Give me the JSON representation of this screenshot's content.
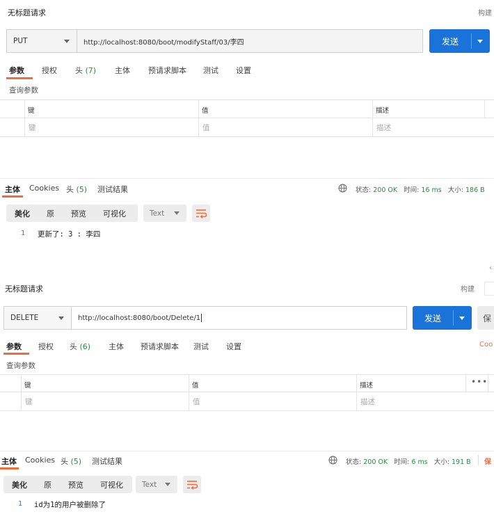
{
  "req1": {
    "title": "无标题请求",
    "build": "构建",
    "method": "PUT",
    "url": "http://localhost:8080/boot/modifyStaff/03/李四",
    "send": "发送",
    "tabs": {
      "params": "参数",
      "auth": "授权",
      "headers": "头",
      "headers_count": "(7)",
      "body": "主体",
      "prerequest": "预请求脚本",
      "tests": "测试",
      "settings": "设置"
    },
    "query_params": "查询参数",
    "table": {
      "key": "键",
      "value": "值",
      "desc": "描述",
      "key_ph": "键",
      "value_ph": "值",
      "desc_ph": "描述"
    },
    "resp_tabs": {
      "body": "主体",
      "cookies": "Cookies",
      "headers": "头",
      "headers_count": "(5)",
      "test_results": "测试结果"
    },
    "status": {
      "status_label": "状态:",
      "status_value": "200 OK",
      "time_label": "时间:",
      "time_value": "16 ms",
      "size_label": "大小:",
      "size_value": "186 B"
    },
    "view": {
      "pretty": "美化",
      "raw": "原",
      "preview": "预览",
      "visualize": "可视化",
      "format": "Text"
    },
    "code": {
      "line": "1",
      "text": "更新了: 3 : 李四"
    }
  },
  "req2": {
    "title": "无标题请求",
    "build": "构建",
    "method": "DELETE",
    "url": "http://localhost:8080/boot/Delete/1",
    "send": "发送",
    "save_partial": "保",
    "cookies_partial": "Coo",
    "tabs": {
      "params": "参数",
      "auth": "授权",
      "headers": "头",
      "headers_count": "(6)",
      "body": "主体",
      "prerequest": "预请求脚本",
      "tests": "测试",
      "settings": "设置"
    },
    "query_params": "查询参数",
    "table": {
      "key": "键",
      "value": "值",
      "desc": "描述",
      "key_ph": "键",
      "value_ph": "值",
      "desc_ph": "描述"
    },
    "resp_tabs": {
      "body": "主体",
      "cookies": "Cookies",
      "headers": "头",
      "headers_count": "(5)",
      "test_results": "测试结果"
    },
    "status": {
      "status_label": "状态:",
      "status_value": "200 OK",
      "time_label": "时间:",
      "time_value": "6 ms",
      "size_label": "大小:",
      "size_value": "191 B",
      "save_partial": "保"
    },
    "view": {
      "pretty": "美化",
      "raw": "原",
      "preview": "预览",
      "visualize": "可视化",
      "format": "Text"
    },
    "code": {
      "line": "1",
      "text": "id为1的用户被删除了"
    }
  },
  "colors": {
    "accent": "#f26b3a",
    "primary": "#1a73d9",
    "success": "#2a8c3f",
    "line_number": "#2f78c6"
  }
}
